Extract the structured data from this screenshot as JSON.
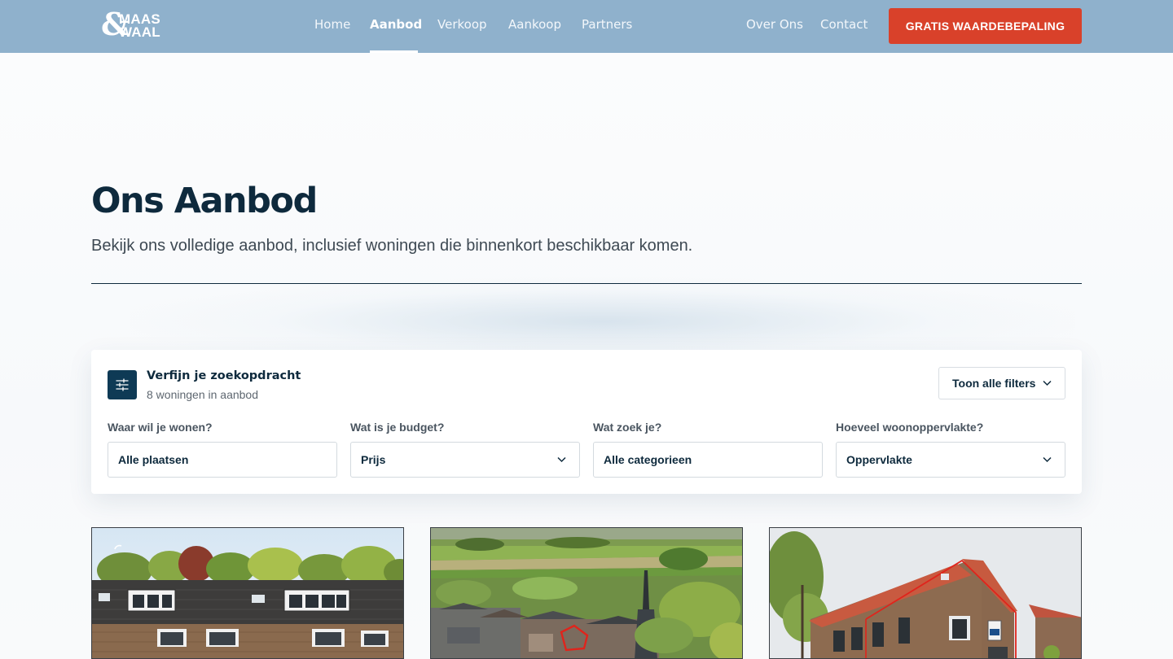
{
  "brand": {
    "logo_ampersand": "&",
    "logo_word1": "MAAS",
    "logo_word2": "WAAL"
  },
  "nav": {
    "items": [
      "Home",
      "Aanbod",
      "Verkoop",
      "Aankoop",
      "Partners"
    ],
    "active": "Aanbod",
    "secondary": [
      "Over Ons",
      "Contact"
    ],
    "cta_label": "GRATIS WAARDEBEPALING"
  },
  "hero": {
    "title": "Ons Aanbod",
    "subtitle": "Bekijk ons volledige aanbod, inclusief woningen die binnenkort beschikbaar komen."
  },
  "filters": {
    "icon": "sliders-icon",
    "heading": "Verfijn je zoekopdracht",
    "count_text": "8 woningen in aanbod",
    "toggle_label": "Toon alle filters",
    "fields": [
      {
        "label": "Waar wil je wonen?",
        "value": "Alle plaatsen",
        "dropdown": false
      },
      {
        "label": "Wat is je budget?",
        "value": "Prijs",
        "dropdown": true
      },
      {
        "label": "Wat zoek je?",
        "value": "Alle categorieen",
        "dropdown": false
      },
      {
        "label": "Hoeveel woonoppervlakte?",
        "value": "Oppervlakte",
        "dropdown": true
      }
    ]
  },
  "colors": {
    "header_bg": "#8fb1cc",
    "cta_bg": "#d9412a",
    "navy": "#0e2a3d",
    "filter_icon_bg": "#0e3a55"
  }
}
